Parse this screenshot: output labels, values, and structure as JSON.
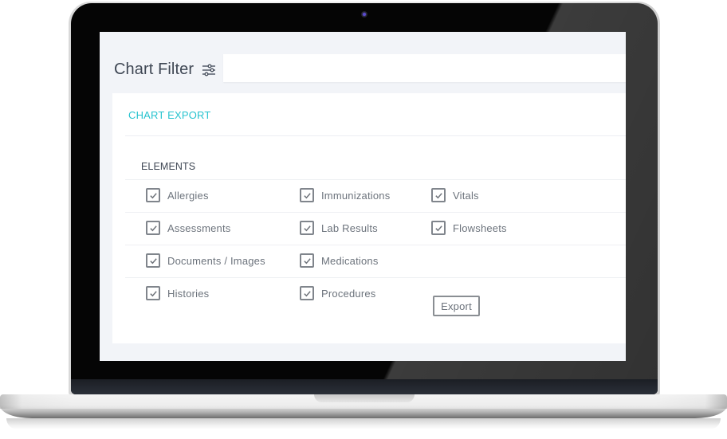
{
  "header": {
    "title": "Chart Filter",
    "filter_icon": "sliders-icon",
    "search_value": ""
  },
  "card": {
    "title": "CHART EXPORT",
    "section_label": "ELEMENTS",
    "elements": [
      {
        "label": "Allergies",
        "checked": true
      },
      {
        "label": "Immunizations",
        "checked": true
      },
      {
        "label": "Vitals",
        "checked": true
      },
      {
        "label": "Assessments",
        "checked": true
      },
      {
        "label": "Lab Results",
        "checked": true
      },
      {
        "label": "Flowsheets",
        "checked": true
      },
      {
        "label": "Documents / Images",
        "checked": true
      },
      {
        "label": "Medications",
        "checked": true
      },
      {
        "label": "Histories",
        "checked": true
      },
      {
        "label": "Procedures",
        "checked": true
      }
    ],
    "export_label": "Export"
  },
  "colors": {
    "accent": "#27c3cf",
    "text_dark": "#3f4754",
    "text_muted": "#6c737c",
    "screen_bg": "#f2f4f8"
  }
}
